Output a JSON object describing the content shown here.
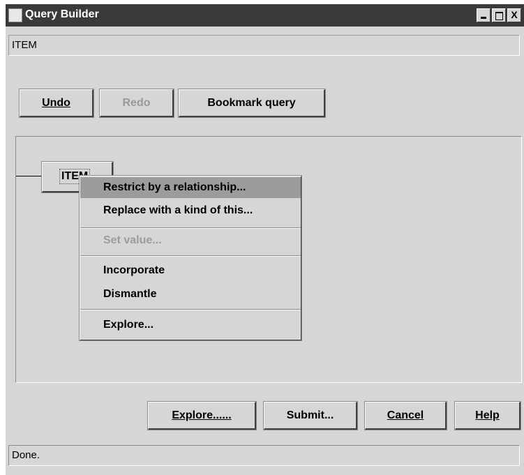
{
  "window": {
    "title": "Query Builder",
    "path": "ITEM",
    "controls": {
      "minimize": "_",
      "maximize": "□",
      "close": "X"
    }
  },
  "toolbar": {
    "undo_label": "Undo",
    "redo_label": "Redo",
    "bookmark_label": "Bookmark query"
  },
  "canvas": {
    "node_label": "ITEM"
  },
  "context_menu": {
    "items": [
      "Restrict by a relationship...",
      "Replace with a kind of this...",
      "Set value...",
      "Incorporate",
      "Dismantle",
      "Explore..."
    ]
  },
  "footer": {
    "explore_label": "Explore......",
    "submit_label": "Submit...",
    "cancel_label": "Cancel",
    "help_label": "Help"
  },
  "status": {
    "text": "Done."
  }
}
